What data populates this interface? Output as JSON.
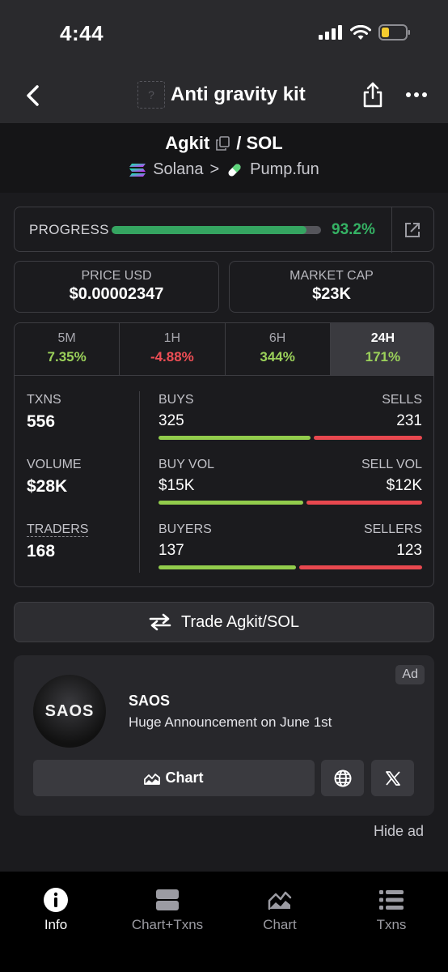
{
  "status_bar": {
    "time": "4:44"
  },
  "header": {
    "title": "Anti gravity kit",
    "logo_placeholder": "?"
  },
  "pair": {
    "base": "Agkit",
    "quote": "/ SOL",
    "chain": "Solana",
    "separator": ">",
    "dex": "Pump.fun"
  },
  "progress": {
    "label": "PROGRESS",
    "value_text": "93.2%",
    "fraction": 0.932
  },
  "price": {
    "label": "PRICE USD",
    "value": "$0.00002347"
  },
  "market_cap": {
    "label": "MARKET CAP",
    "value": "$23K"
  },
  "timeframes": [
    {
      "label": "5M",
      "change": "7.35%",
      "direction": "up"
    },
    {
      "label": "1H",
      "change": "-4.88%",
      "direction": "down"
    },
    {
      "label": "6H",
      "change": "344%",
      "direction": "up"
    },
    {
      "label": "24H",
      "change": "171%",
      "direction": "up",
      "active": true
    }
  ],
  "stats": {
    "txns": {
      "label": "TXNS",
      "value": "556"
    },
    "volume": {
      "label": "VOLUME",
      "value": "$28K"
    },
    "traders": {
      "label": "TRADERS",
      "value": "168"
    }
  },
  "breakdowns": [
    {
      "left_label": "BUYS",
      "right_label": "SELLS",
      "left_value": "325",
      "right_value": "231",
      "left_share": 0.585
    },
    {
      "left_label": "BUY VOL",
      "right_label": "SELL VOL",
      "left_value": "$15K",
      "right_value": "$12K",
      "left_share": 0.556
    },
    {
      "left_label": "BUYERS",
      "right_label": "SELLERS",
      "left_value": "137",
      "right_value": "123",
      "left_share": 0.527
    }
  ],
  "trade_button": {
    "label": "Trade Agkit/SOL"
  },
  "ad": {
    "badge": "Ad",
    "logo_text": "SAOS",
    "name": "SAOS",
    "description": "Huge Announcement on June 1st",
    "chart_label": "Chart",
    "hide_label": "Hide ad"
  },
  "tab_bar": [
    {
      "label": "Info",
      "icon": "info-icon",
      "active": true
    },
    {
      "label": "Chart+Txns",
      "icon": "split-view-icon"
    },
    {
      "label": "Chart",
      "icon": "area-chart-icon"
    },
    {
      "label": "Txns",
      "icon": "list-icon"
    }
  ],
  "colors": {
    "positive": "#9bd15a",
    "negative": "#ef4e55",
    "progress": "#35a561",
    "background": "#1b1b1e"
  }
}
